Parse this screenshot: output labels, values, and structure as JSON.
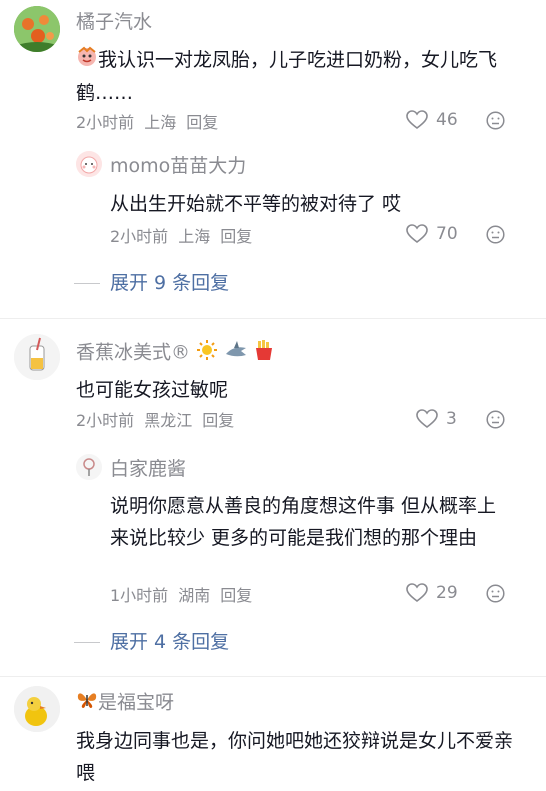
{
  "comments": [
    {
      "username": "橘子汽水",
      "text": "我认识一对龙凤胎，儿子吃进口奶粉，女儿吃飞鹤……",
      "time": "2小时前",
      "location": "上海",
      "reply_label": "回复",
      "likes": "46",
      "replies": [
        {
          "username": "momo苗苗大力",
          "text": "从出生开始就不平等的被对待了 哎",
          "time": "2小时前",
          "location": "上海",
          "reply_label": "回复",
          "likes": "70"
        }
      ],
      "expand_label": "展开 9 条回复"
    },
    {
      "username": "香蕉冰美式®",
      "text": "也可能女孩过敏呢",
      "time": "2小时前",
      "location": "黑龙江",
      "reply_label": "回复",
      "likes": "3",
      "replies": [
        {
          "username": "白家鹿酱",
          "text": "说明你愿意从善良的角度想这件事 但从概率上来说比较少 更多的可能是我们想的那个理由",
          "time": "1小时前",
          "location": "湖南",
          "reply_label": "回复",
          "likes": "29"
        }
      ],
      "expand_label": "展开 4 条回复"
    },
    {
      "username": "是福宝呀",
      "text": "我身边同事也是，你问她吧她还狡辩说是女儿不爱亲喂"
    }
  ],
  "colors": {
    "text": "#161823",
    "meta": "#8a8b91",
    "link": "#4e6fa3"
  }
}
